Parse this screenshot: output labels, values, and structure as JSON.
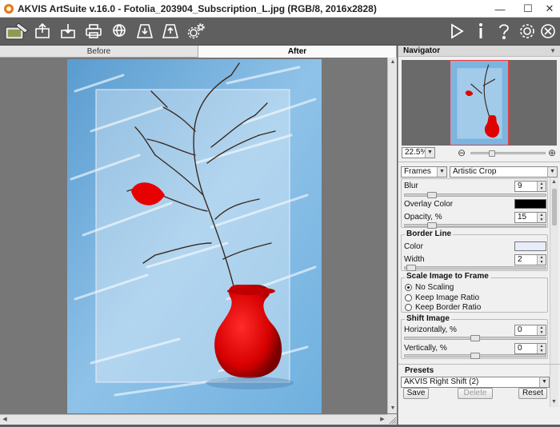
{
  "window": {
    "title": "AKVIS ArtSuite v.16.0 - Fotolia_203904_Subscription_L.jpg (RGB/8, 2016x2828)",
    "minimize_icon": "minimize-icon",
    "maximize_icon": "maximize-icon",
    "close_icon": "close-icon"
  },
  "toolbar": {
    "left_icons": [
      "artsuite-logo-icon",
      "open-image-icon",
      "save-image-icon",
      "print-icon",
      "share-icon",
      "import-preset-icon",
      "export-preset-icon",
      "settings-gear-icon"
    ],
    "right_icons": [
      "run-icon",
      "info-icon",
      "help-icon",
      "preferences-icon",
      "close-tool-icon"
    ]
  },
  "canvas": {
    "tab_before": "Before",
    "tab_after": "After",
    "active_tab": "After"
  },
  "navigator": {
    "title": "Navigator",
    "zoom": "22.5%",
    "zoom_out": "⊖",
    "zoom_in": "⊕"
  },
  "effect": {
    "category": "Frames",
    "type": "Artistic Crop"
  },
  "settings": {
    "blur_label": "Blur",
    "blur_value": "9",
    "overlay_color_label": "Overlay Color",
    "overlay_color": "#000000",
    "opacity_label": "Opacity, %",
    "opacity_value": "15",
    "border_line_title": "Border Line",
    "color_label": "Color",
    "border_color": "#e8ecf8",
    "width_label": "Width",
    "width_value": "2",
    "scale_title": "Scale Image to Frame",
    "no_scaling": "No Scaling",
    "keep_image_ratio": "Keep Image Ratio",
    "keep_border_ratio": "Keep Border Ratio",
    "scale_selected": "No Scaling",
    "shift_title": "Shift Image",
    "horizontally_label": "Horizontally, %",
    "horizontally_value": "0",
    "vertically_label": "Vertically, %",
    "vertically_value": "0"
  },
  "presets": {
    "title": "Presets",
    "selected": "AKVIS Right Shift (2)",
    "save": "Save",
    "delete": "Delete",
    "reset": "Reset"
  }
}
